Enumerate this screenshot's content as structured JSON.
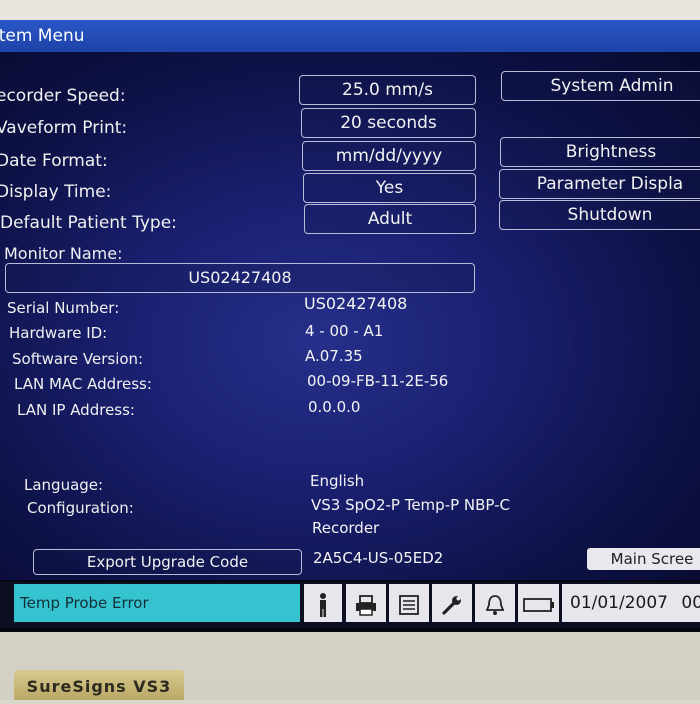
{
  "window": {
    "title": "item Menu"
  },
  "settings": [
    {
      "label": "ecorder Speed:",
      "value": "25.0 mm/s"
    },
    {
      "label": "Vaveform Print:",
      "value": "20 seconds"
    },
    {
      "label": "Date Format:",
      "value": "mm/dd/yyyy"
    },
    {
      "label": "Display Time:",
      "value": "Yes"
    },
    {
      "label": "Default Patient Type:",
      "value": "Adult"
    }
  ],
  "right_buttons": [
    "System Admin",
    "Brightness",
    "Parameter Displa",
    "Shutdown"
  ],
  "monitor": {
    "label": "Monitor Name:",
    "value": "US02427408"
  },
  "info": [
    {
      "label": "Serial Number:",
      "value": "US02427408"
    },
    {
      "label": "Hardware ID:",
      "value": "4 - 00 - A1"
    },
    {
      "label": "Software Version:",
      "value": "A.07.35"
    },
    {
      "label": "LAN MAC Address:",
      "value": "00-09-FB-11-2E-56"
    },
    {
      "label": "LAN IP Address:",
      "value": "0.0.0.0"
    }
  ],
  "language": {
    "label": "Language:",
    "value": "English"
  },
  "configuration": {
    "label": "Configuration:",
    "line1": "VS3 SpO2-P Temp-P NBP-C",
    "line2": "Recorder"
  },
  "export": {
    "button": "Export Upgrade Code",
    "code": "2A5C4-US-05ED2"
  },
  "main_screen": "Main Scree",
  "status": {
    "message": "Temp Probe Error",
    "date": "01/01/2007",
    "time_fragment": "00"
  },
  "status_icons": [
    "person-icon",
    "printer-icon",
    "document-icon",
    "wrench-icon",
    "bell-icon",
    "battery-icon"
  ],
  "brand": "SureSigns VS3",
  "colors": {
    "title_bar": "#1d43a8",
    "status_alert": "#35c3d0",
    "panel": "#1a2070"
  }
}
